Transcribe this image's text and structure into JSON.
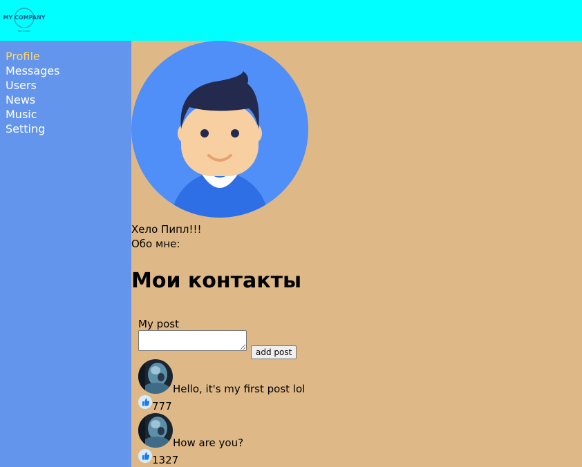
{
  "header": {
    "logo": {
      "text": "MY COMPANY",
      "tagline": "tag slogan"
    }
  },
  "sidebar": {
    "items": [
      {
        "label": "Profile",
        "active": true
      },
      {
        "label": "Messages"
      },
      {
        "label": "Users"
      },
      {
        "label": "News"
      },
      {
        "label": "Music"
      },
      {
        "label": "Setting"
      }
    ]
  },
  "profile": {
    "greeting": "Хело Пипл!!!",
    "about": "Обо мне:",
    "contacts_title": "Мои контакты"
  },
  "new_post": {
    "label": "My post",
    "input_value": "",
    "button_label": "add post"
  },
  "posts": [
    {
      "text": "Hello, it's my first post lol",
      "likes": "777"
    },
    {
      "text": "How are you?",
      "likes": "1327"
    }
  ],
  "colors": {
    "header_bg": "#00ffff",
    "sidebar_bg": "#6495ed",
    "content_bg": "#deb887",
    "active_nav": "#ffd966"
  },
  "icons": [
    "company-logo",
    "user-avatar-icon",
    "post-author-avatar",
    "thumbs-up-icon"
  ]
}
